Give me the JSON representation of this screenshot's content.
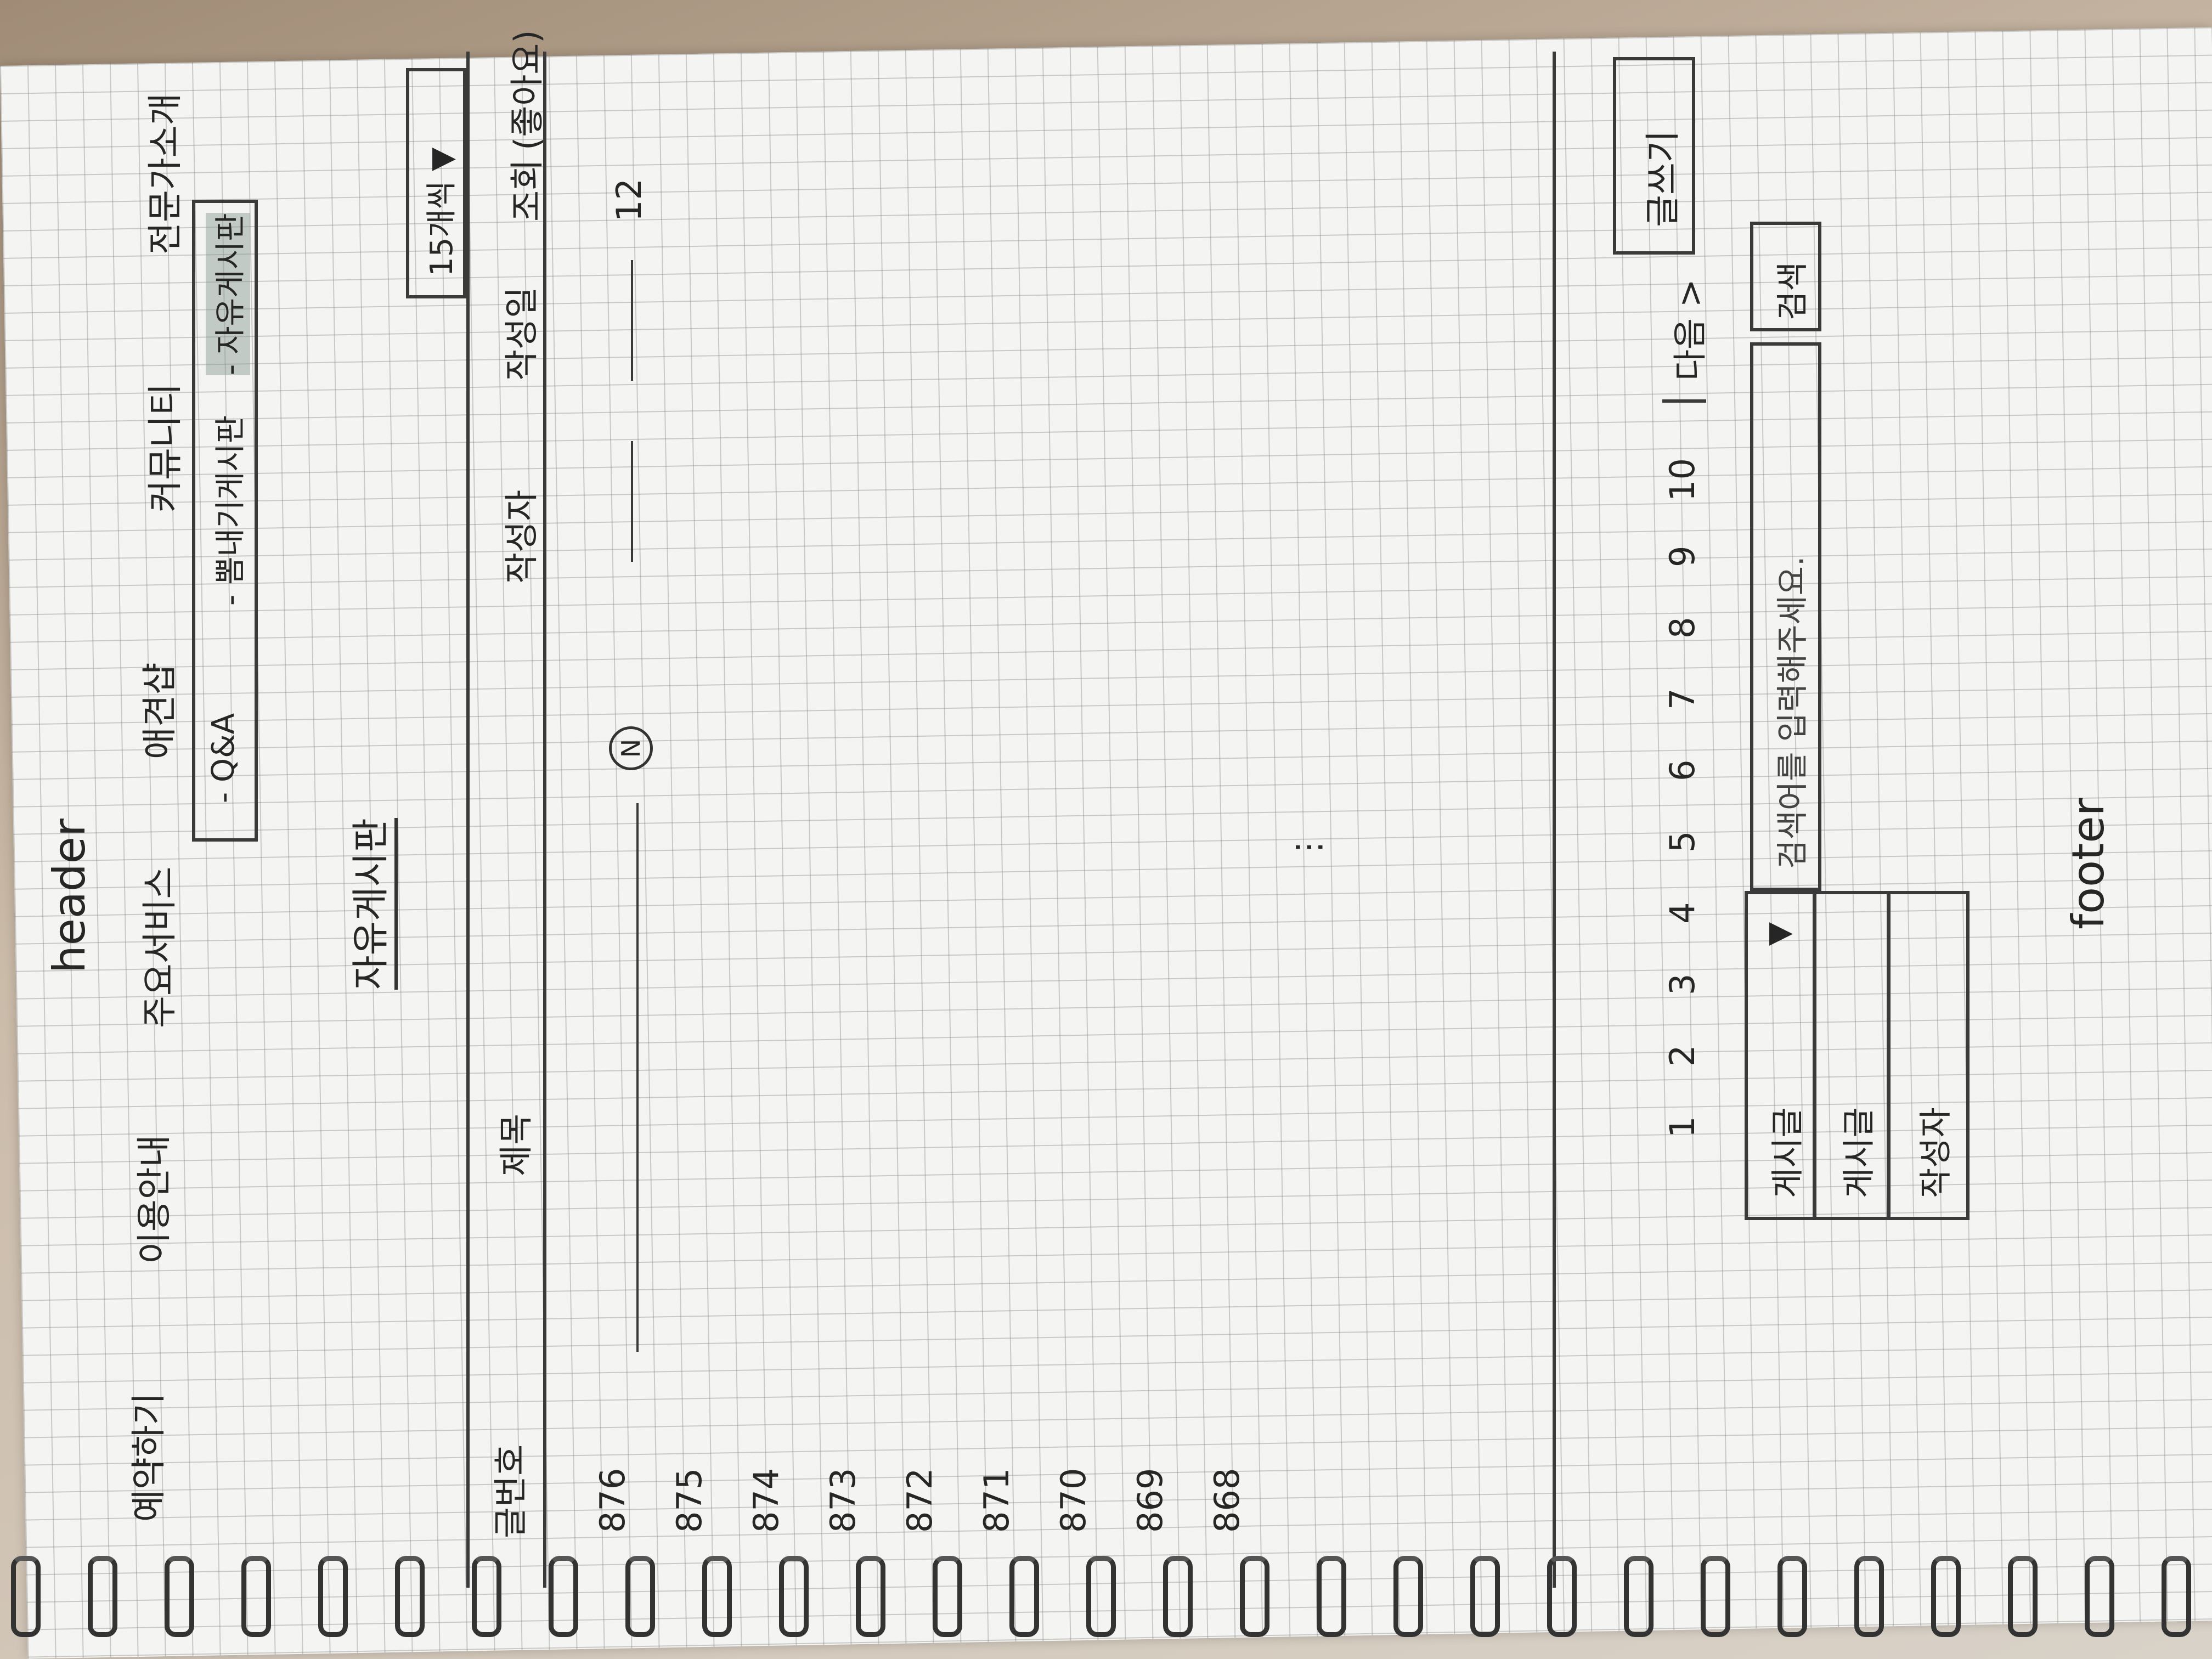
{
  "header": {
    "label": "header"
  },
  "nav": {
    "items": [
      "예약하기",
      "이용안내",
      "주요서비스",
      "애견샵",
      "커뮤니티",
      "전문가소개"
    ]
  },
  "community_dropdown": {
    "items": [
      "- Q&A",
      "- 뽐내기게시판",
      "- 자유게시판"
    ]
  },
  "board": {
    "title": "자유게시판",
    "per_page_select": "15개씩 ▼",
    "columns": [
      "글번호",
      "제목",
      "작성자",
      "작성일",
      "조회",
      "(좋아요)"
    ],
    "new_badge": "N",
    "first_views": "12",
    "rows": [
      "876",
      "875",
      "874",
      "873",
      "872",
      "871",
      "870",
      "869",
      "868"
    ]
  },
  "pagination": {
    "pages": [
      "1",
      "2",
      "3",
      "4",
      "5",
      "6",
      "7",
      "8",
      "9",
      "10"
    ],
    "next_label": "다음 >"
  },
  "write_button": "글쓰기",
  "search": {
    "select_value": "게시글",
    "select_arrow": "▼",
    "options": [
      "게시글",
      "작성자"
    ],
    "placeholder": "검색어를 입력해주세요.",
    "button": "검색"
  },
  "footer": {
    "label": "footer"
  }
}
